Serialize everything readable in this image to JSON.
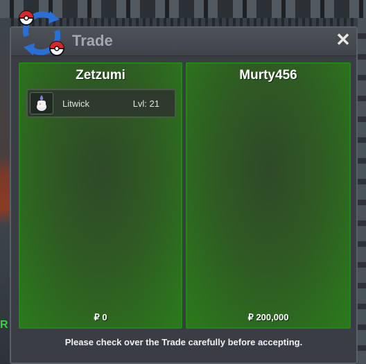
{
  "window": {
    "title": "Trade",
    "close_icon": "close-icon",
    "logo_icon": "trade-exchange-icon"
  },
  "left_panel": {
    "player_name": "Zetzumi",
    "pokemon": [
      {
        "name": "Litwick",
        "level": "Lvl: 21",
        "icon": "litwick-sprite-icon"
      }
    ],
    "money": "₽ 0"
  },
  "right_panel": {
    "player_name": "Murty456",
    "pokemon": [],
    "money": "₽ 200,000"
  },
  "footer": {
    "notice": "Please check over the Trade carefully before accepting."
  },
  "colors": {
    "panel_border": "#1f8a12",
    "panel_fill": "#2f5a23",
    "window_bg": "#3a3e44"
  }
}
